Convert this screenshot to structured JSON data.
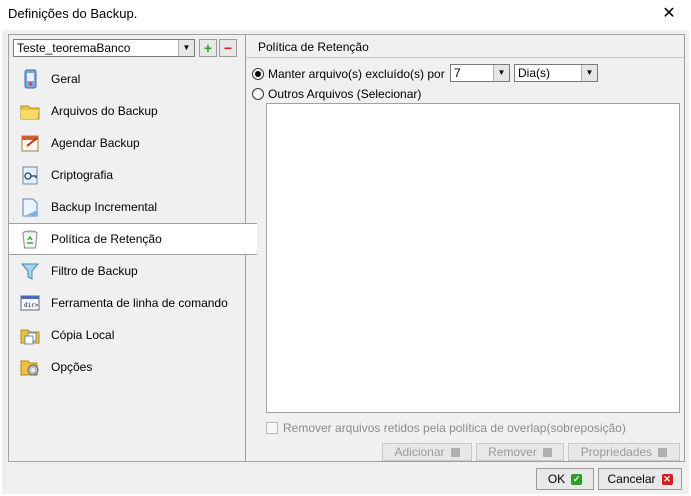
{
  "window": {
    "title": "Definições do Backup."
  },
  "profile": {
    "selected": "Teste_teoremaBanco",
    "add_label": "+",
    "remove_label": "−"
  },
  "nav": {
    "items": [
      {
        "label": "Geral",
        "icon": "general-icon"
      },
      {
        "label": "Arquivos do Backup",
        "icon": "folder-icon"
      },
      {
        "label": "Agendar Backup",
        "icon": "schedule-icon"
      },
      {
        "label": "Criptografia",
        "icon": "encryption-icon"
      },
      {
        "label": "Backup Incremental",
        "icon": "incremental-icon"
      },
      {
        "label": "Política de Retenção",
        "icon": "recycle-bin-icon",
        "active": true
      },
      {
        "label": "Filtro de Backup",
        "icon": "filter-icon"
      },
      {
        "label": "Ferramenta de linha de comando",
        "icon": "command-line-icon"
      },
      {
        "label": "Cópia Local",
        "icon": "local-copy-icon"
      },
      {
        "label": "Opções",
        "icon": "options-icon"
      }
    ]
  },
  "retention": {
    "section_title": "Política de Retenção",
    "keep_deleted_label": "Manter arquivo(s) excluído(s) por",
    "keep_count": "7",
    "keep_unit": "Dia(s)",
    "other_files_label": "Outros Arquivos (Selecionar)",
    "remove_retained_label": "Remover arquivos retidos  pela política de overlap(sobreposição)",
    "add_button": "Adicionar",
    "remove_button": "Remover",
    "properties_button": "Propriedades"
  },
  "footer": {
    "ok_label": "OK",
    "cancel_label": "Cancelar"
  },
  "colors": {
    "accent_green": "#2aa02a",
    "accent_red": "#d02020"
  }
}
